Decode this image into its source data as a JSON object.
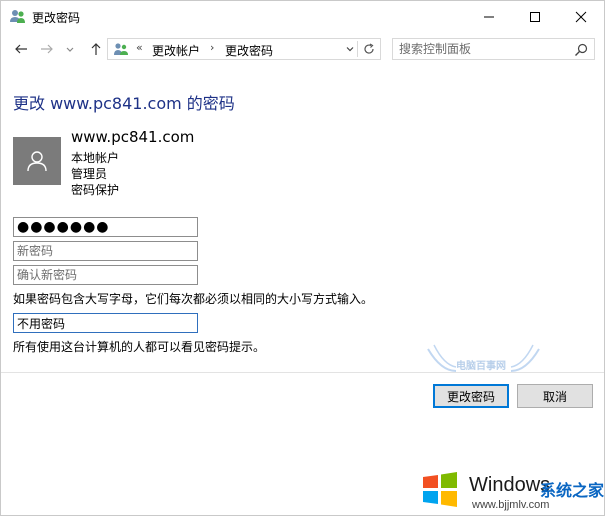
{
  "window": {
    "title": "更改密码",
    "minimize_icon": "minimize-icon",
    "maximize_icon": "maximize-icon",
    "close_icon": "close-icon"
  },
  "nav": {
    "back_icon": "arrow-left-icon",
    "forward_icon": "arrow-right-icon",
    "recent_icon": "chevron-down-icon",
    "up_icon": "arrow-up-icon",
    "breadcrumb": [
      "更改帐户",
      "更改密码"
    ],
    "breadcrumb_overflow": "«",
    "breadcrumb_separator": "›",
    "refresh_icon": "refresh-icon",
    "search_placeholder": "搜索控制面板"
  },
  "page": {
    "heading": "更改 www.pc841.com 的密码",
    "account": {
      "name": "www.pc841.com",
      "lines": [
        "本地帐户",
        "管理员",
        "密码保护"
      ]
    },
    "current_password_value": "●●●●●●●",
    "new_password_placeholder": "新密码",
    "confirm_password_placeholder": "确认新密码",
    "case_note": "如果密码包含大写字母，它们每次都必须以相同的大小写方式输入。",
    "hint_value": "不用密码",
    "hint_note": "所有使用这台计算机的人都可以看见密码提示。"
  },
  "buttons": {
    "change_password": "更改密码",
    "cancel": "取消"
  },
  "watermark": {
    "top_text": "电脑百事网",
    "windows": "Windows",
    "brand": "系统之家",
    "url": "www.bjjmlv.com"
  }
}
